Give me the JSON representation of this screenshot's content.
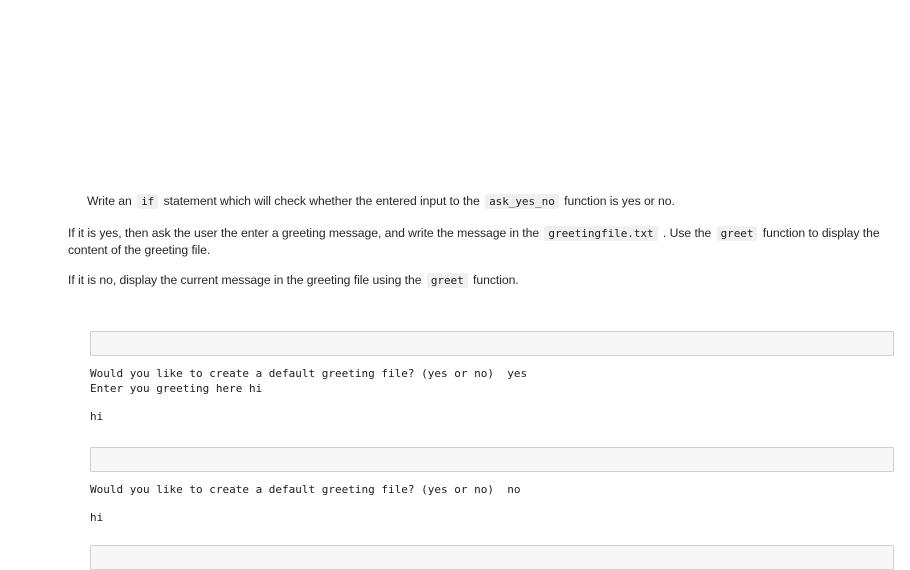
{
  "document": {
    "instructions": [
      {
        "id": "task-if-statement",
        "indented": true,
        "segments": [
          {
            "type": "text",
            "value": "Write an "
          },
          {
            "type": "code",
            "value": "if"
          },
          {
            "type": "text",
            "value": " statement which will check whether the entered input to the "
          },
          {
            "type": "code",
            "value": "ask_yes_no"
          },
          {
            "type": "text",
            "value": " function is yes or no."
          }
        ]
      },
      {
        "id": "task-yes-branch",
        "indented": false,
        "segments": [
          {
            "type": "text",
            "value": "If it is yes, then ask the user the enter a greeting message, and write the message in the "
          },
          {
            "type": "code",
            "value": "greetingfile.txt"
          },
          {
            "type": "text",
            "value": " . Use the "
          },
          {
            "type": "code",
            "value": "greet"
          },
          {
            "type": "text",
            "value": " function to display the content of the greeting file."
          }
        ]
      },
      {
        "id": "task-no-branch",
        "indented": false,
        "segments": [
          {
            "type": "text",
            "value": "If it is no, display the current message in the greeting file using the "
          },
          {
            "type": "code",
            "value": "greet"
          },
          {
            "type": "text",
            "value": " function."
          }
        ]
      }
    ]
  },
  "notebook": {
    "cells": [
      {
        "id": "cell-1",
        "input_value": "",
        "input_placeholder": "",
        "stream_output": "Would you like to create a default greeting file? (yes or no)  yes\nEnter you greeting here hi",
        "result_output": "hi"
      },
      {
        "id": "cell-2",
        "input_value": "",
        "input_placeholder": "",
        "stream_output": "Would you like to create a default greeting file? (yes or no)  no",
        "result_output": "hi"
      },
      {
        "id": "cell-3",
        "input_value": "",
        "input_placeholder": "",
        "stream_output": "",
        "result_output": ""
      }
    ]
  },
  "theme": {
    "page_background": "#ffffff",
    "text_color": "#262626",
    "code_span_background": "#f0f0f0",
    "cell_background": "#f7f7f7",
    "cell_border": "#cfcfcf"
  }
}
